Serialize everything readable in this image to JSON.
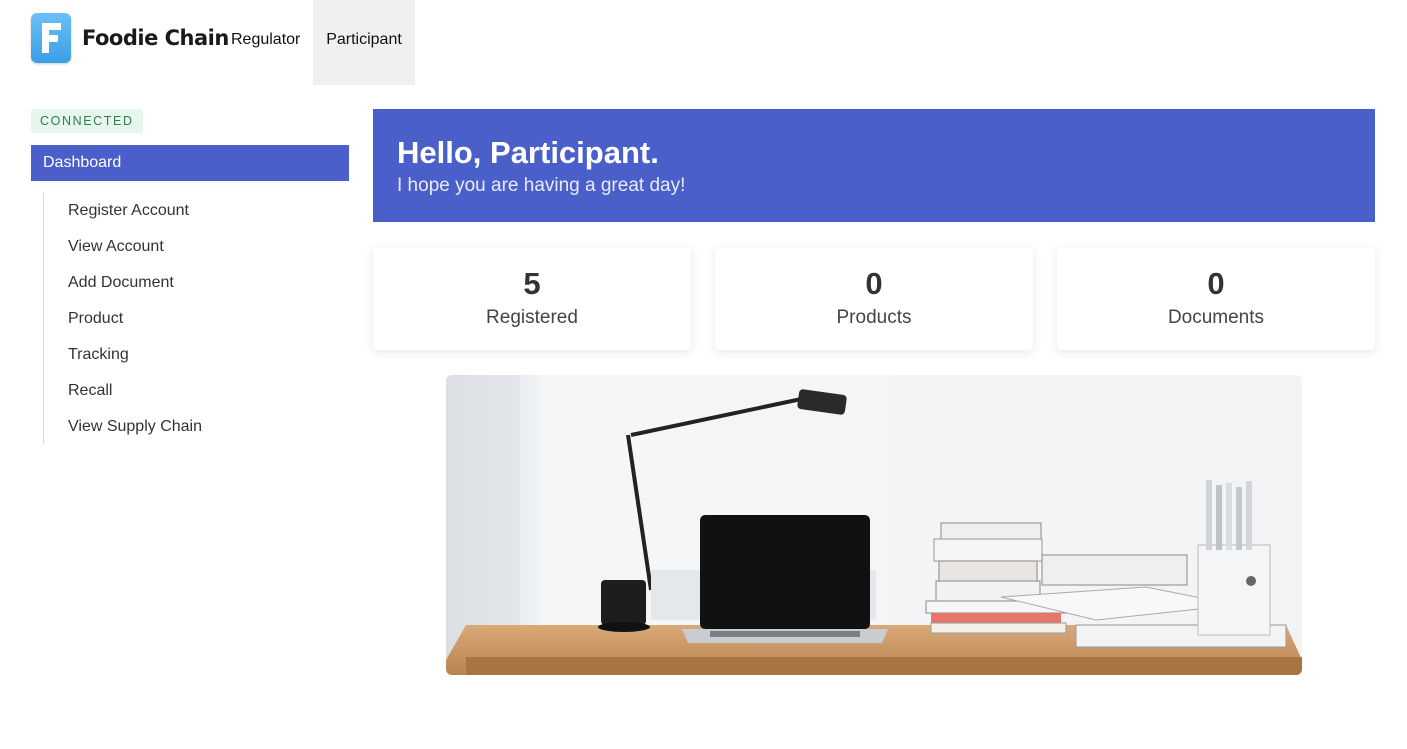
{
  "app": {
    "brand_name": "Foodie Chain",
    "brand_letter": "F",
    "accent_color": "#4a5fca"
  },
  "nav": {
    "tabs": [
      {
        "label": "Regulator",
        "active": false
      },
      {
        "label": "Participant",
        "active": true
      }
    ]
  },
  "sidebar": {
    "status": "CONNECTED",
    "active_item": "Dashboard",
    "items": [
      {
        "label": "Register Account"
      },
      {
        "label": "View Account"
      },
      {
        "label": "Add Document"
      },
      {
        "label": "Product"
      },
      {
        "label": "Tracking"
      },
      {
        "label": "Recall"
      },
      {
        "label": "View Supply Chain"
      }
    ]
  },
  "hero": {
    "title": "Hello, Participant.",
    "subtitle": "I hope you are having a great day!"
  },
  "stats": [
    {
      "value": "5",
      "label": "Registered"
    },
    {
      "value": "0",
      "label": "Products"
    },
    {
      "value": "0",
      "label": "Documents"
    }
  ]
}
